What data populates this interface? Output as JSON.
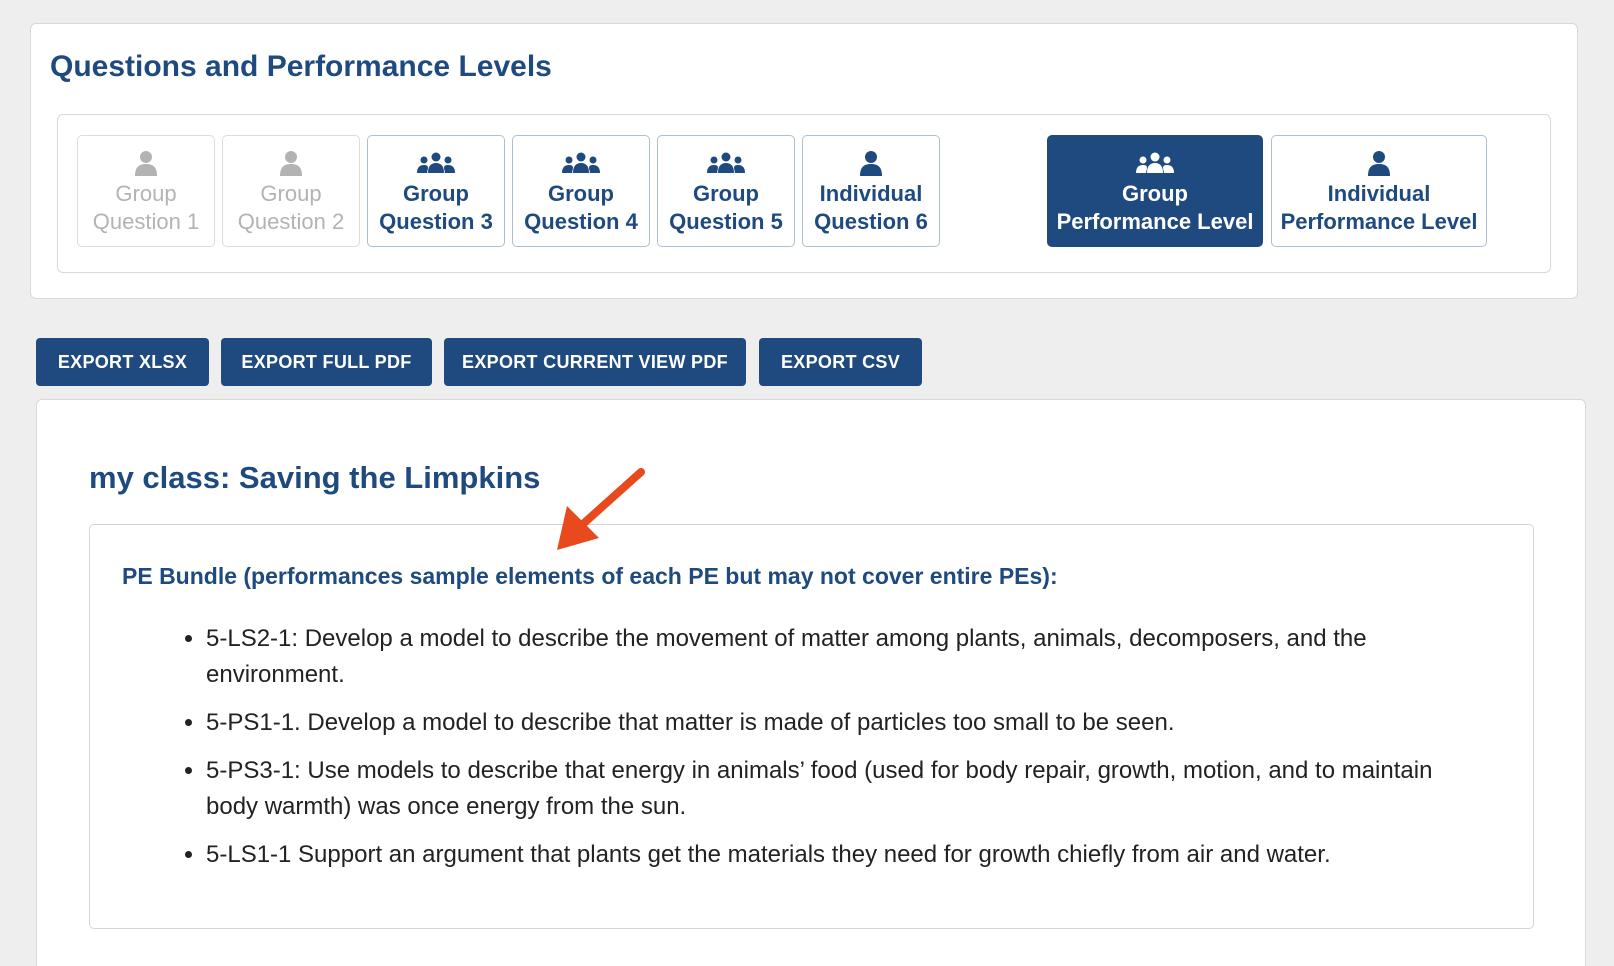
{
  "header": {
    "title": "Questions and Performance Levels"
  },
  "question_buttons": [
    {
      "line1": "Group",
      "line2": "Question 1",
      "icon": "person-icon",
      "state": "disabled"
    },
    {
      "line1": "Group",
      "line2": "Question 2",
      "icon": "person-icon",
      "state": "disabled"
    },
    {
      "line1": "Group",
      "line2": "Question 3",
      "icon": "group-icon",
      "state": "normal"
    },
    {
      "line1": "Group",
      "line2": "Question 4",
      "icon": "group-icon",
      "state": "normal"
    },
    {
      "line1": "Group",
      "line2": "Question 5",
      "icon": "group-icon",
      "state": "normal"
    },
    {
      "line1": "Individual",
      "line2": "Question 6",
      "icon": "person-icon",
      "state": "normal"
    }
  ],
  "performance_buttons": [
    {
      "line1": "Group",
      "line2": "Performance Level",
      "icon": "group-icon",
      "state": "active"
    },
    {
      "line1": "Individual",
      "line2": "Performance Level",
      "icon": "person-icon",
      "state": "normal"
    }
  ],
  "export": {
    "xlsx": "EXPORT XLSX",
    "full_pdf": "EXPORT FULL PDF",
    "current_view_pdf": "EXPORT CURRENT VIEW PDF",
    "csv": "EXPORT CSV"
  },
  "main": {
    "class_title": "my class: Saving the Limpkins",
    "pe_heading": "PE Bundle (performances sample elements of each PE but may not cover entire PEs):",
    "pe_items": [
      "5-LS2-1: Develop a model to describe the movement of matter among plants, animals, decomposers, and the environment.",
      "5-PS1-1. Develop a model to describe that matter is made of particles too small to be seen.",
      "5-PS3-1: Use models to describe that energy in animals’ food (used for body repair, growth, motion, and to maintain body warmth) was once energy from the sun.",
      "5-LS1-1 Support an argument that plants get the materials they need for growth chiefly from air and water."
    ]
  },
  "colors": {
    "brand": "#1f4a7f",
    "annotation_arrow": "#e8491d",
    "disabled": "#b3b3b3"
  }
}
